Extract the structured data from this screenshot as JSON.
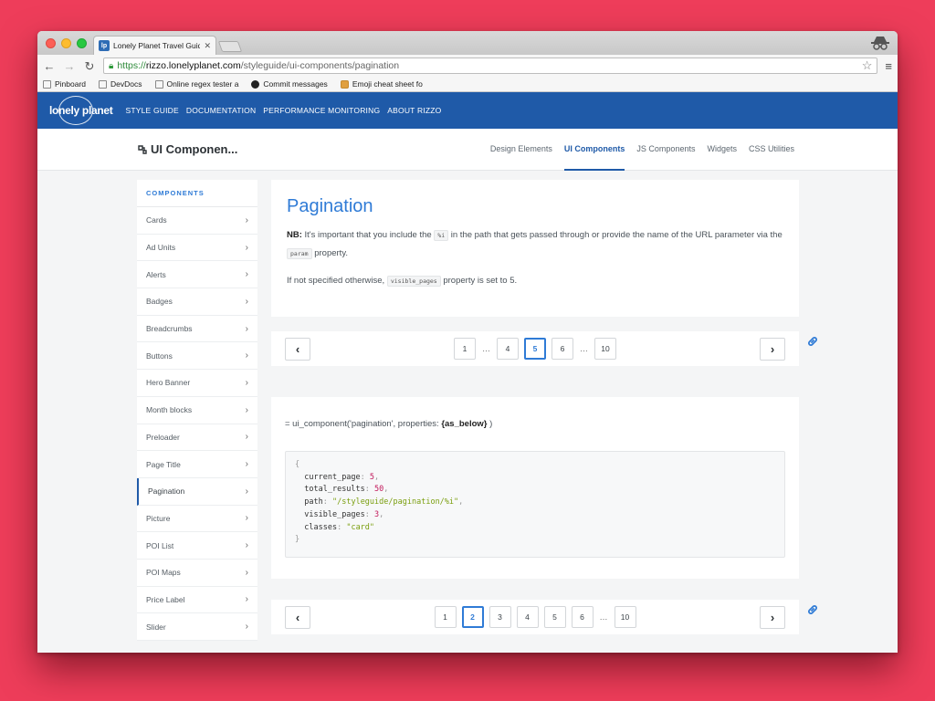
{
  "browser": {
    "tab_title": "Lonely Planet Travel Guide",
    "tab_favicon": "lp",
    "url_scheme": "https://",
    "url_host": "rizzo.lonelyplanet.com",
    "url_path": "/styleguide/ui-components/pagination",
    "bookmarks": [
      "Pinboard",
      "DevDocs",
      "Online regex tester a",
      "Commit messages",
      "Emoji cheat sheet fo"
    ]
  },
  "site": {
    "logo_text": "lonely planet",
    "nav": [
      "STYLE GUIDE",
      "DOCUMENTATION",
      "PERFORMANCE MONITORING",
      "ABOUT RIZZO"
    ],
    "accent_color": "#1f5aa8"
  },
  "subheader": {
    "title": "UI Componen...",
    "tabs": [
      "Design Elements",
      "UI Components",
      "JS Components",
      "Widgets",
      "CSS Utilities"
    ],
    "active_tab": "UI Components"
  },
  "sidebar": {
    "heading": "COMPONENTS",
    "items": [
      "Cards",
      "Ad Units",
      "Alerts",
      "Badges",
      "Breadcrumbs",
      "Buttons",
      "Hero Banner",
      "Month blocks",
      "Preloader",
      "Page Title",
      "Pagination",
      "Picture",
      "POI List",
      "POI Maps",
      "Price Label",
      "Slider"
    ],
    "active_item": "Pagination"
  },
  "intro": {
    "title": "Pagination",
    "nb_label": "NB:",
    "p1_a": "It's important that you include the",
    "p1_code1": "%i",
    "p1_b": "in the path that gets passed through or provide the name of the URL parameter via the",
    "p1_code2": "param",
    "p1_c": "property.",
    "p2_a": "If not specified otherwise,",
    "p2_code": "visible_pages",
    "p2_b": "property is set to 5."
  },
  "pager1": {
    "prev": "‹",
    "next": "›",
    "pages": [
      "1",
      "…",
      "4",
      "5",
      "6",
      "…",
      "10"
    ],
    "current": "5"
  },
  "code": {
    "call_prefix": "= ui_component('pagination', properties:",
    "call_arg": "{as_below}",
    "call_suffix": ")",
    "open_brace": "{",
    "close_brace": "}",
    "props": [
      {
        "key": "current_page",
        "value": "5",
        "type": "number"
      },
      {
        "key": "total_results",
        "value": "50",
        "type": "number"
      },
      {
        "key": "path",
        "value": "\"/styleguide/pagination/%i\"",
        "type": "string"
      },
      {
        "key": "visible_pages",
        "value": "3",
        "type": "number"
      },
      {
        "key": "classes",
        "value": "\"card\"",
        "type": "string",
        "last": true
      }
    ]
  },
  "pager2": {
    "prev": "‹",
    "next": "›",
    "pages": [
      "1",
      "2",
      "3",
      "4",
      "5",
      "6",
      "…",
      "10"
    ],
    "current": "2"
  }
}
